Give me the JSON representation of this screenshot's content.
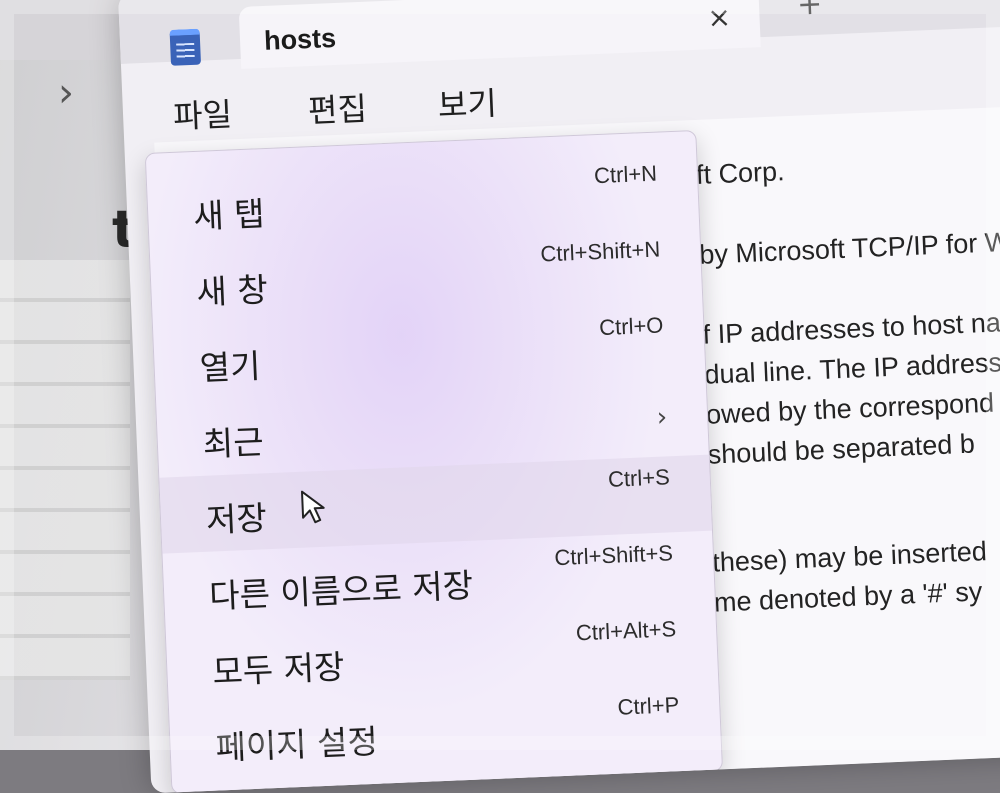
{
  "tab": {
    "title": "hosts",
    "close_glyph": "×",
    "new_tab_glyph": "+"
  },
  "background": {
    "chevron": "›",
    "letter": "t"
  },
  "menubar": {
    "items": [
      "파일",
      "편집",
      "보기"
    ]
  },
  "file_menu": {
    "items": [
      {
        "label": "새 탭",
        "shortcut": "Ctrl+N"
      },
      {
        "label": "새 창",
        "shortcut": "Ctrl+Shift+N"
      },
      {
        "label": "열기",
        "shortcut": "Ctrl+O"
      },
      {
        "label": "최근",
        "submenu_glyph": "›"
      },
      {
        "label": "저장",
        "shortcut": "Ctrl+S"
      },
      {
        "label": "다른 이름으로 저장",
        "shortcut": "Ctrl+Shift+S"
      },
      {
        "label": "모두 저장",
        "shortcut": "Ctrl+Alt+S"
      },
      {
        "label": "페이지 설정",
        "shortcut": "Ctrl+P"
      }
    ]
  },
  "document": {
    "lines": [
      "ft Corp.",
      "by Microsoft TCP/IP for W",
      "f IP addresses to host na",
      "dual line. The IP address",
      "owed by the correspond",
      "should be separated b",
      "these) may be inserted",
      "me denoted by a '#' sy"
    ]
  },
  "colors": {
    "menu_bg": "#f2ecfa",
    "accent": "#3a63b8"
  }
}
